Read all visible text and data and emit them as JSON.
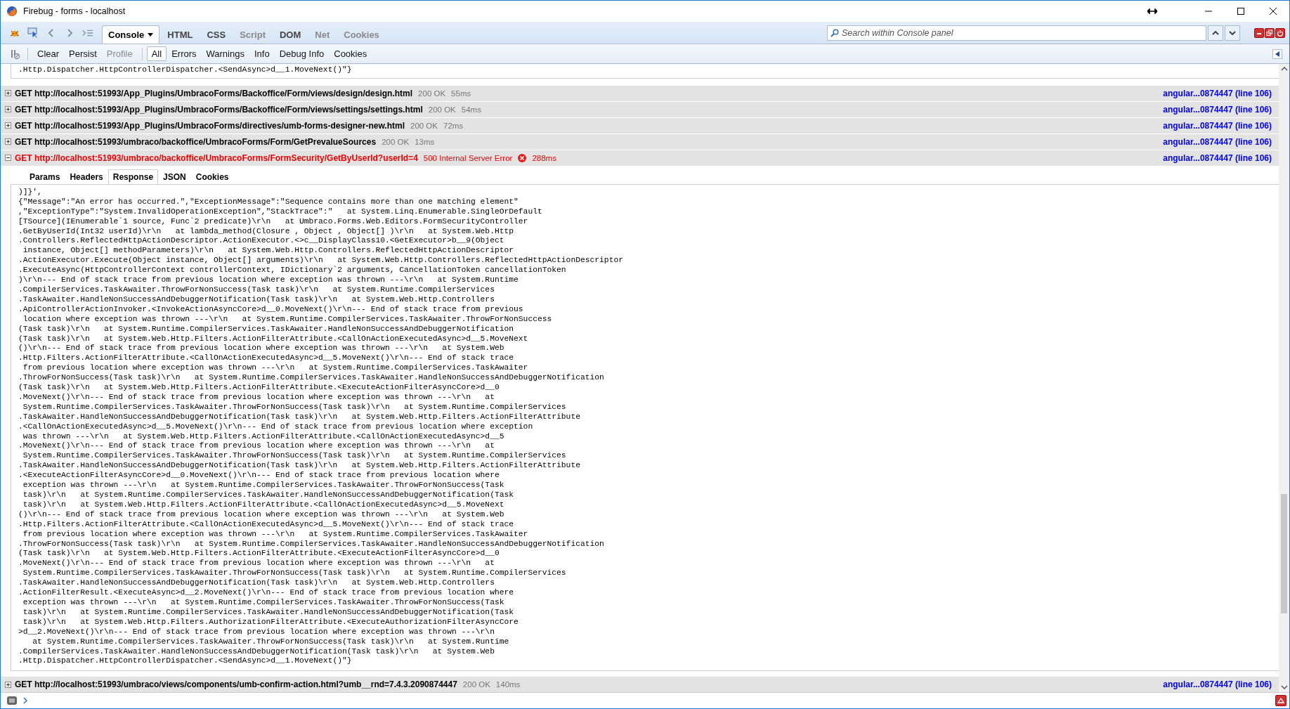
{
  "window": {
    "title": "Firebug - forms - localhost"
  },
  "panel_tabs": [
    {
      "label": "Console",
      "selected": true,
      "disabled": false,
      "dropdown": true
    },
    {
      "label": "HTML",
      "selected": false,
      "disabled": false,
      "dropdown": false
    },
    {
      "label": "CSS",
      "selected": false,
      "disabled": false,
      "dropdown": false
    },
    {
      "label": "Script",
      "selected": false,
      "disabled": true,
      "dropdown": false
    },
    {
      "label": "DOM",
      "selected": false,
      "disabled": false,
      "dropdown": false
    },
    {
      "label": "Net",
      "selected": false,
      "disabled": true,
      "dropdown": false
    },
    {
      "label": "Cookies",
      "selected": false,
      "disabled": true,
      "dropdown": false
    }
  ],
  "search": {
    "placeholder": "Search within Console panel"
  },
  "console_buttons": [
    {
      "label": "Clear",
      "disabled": false
    },
    {
      "label": "Persist",
      "disabled": false
    },
    {
      "label": "Profile",
      "disabled": true
    }
  ],
  "filters": [
    {
      "label": "All",
      "selected": true
    },
    {
      "label": "Errors",
      "selected": false
    },
    {
      "label": "Warnings",
      "selected": false
    },
    {
      "label": "Info",
      "selected": false
    },
    {
      "label": "Debug Info",
      "selected": false
    },
    {
      "label": "Cookies",
      "selected": false
    }
  ],
  "previous_response_tail": ".Http.Dispatcher.HttpControllerDispatcher.<SendAsync>d__1.MoveNext()\"}",
  "requests": [
    {
      "request": "GET http://localhost:51993/App_Plugins/UmbracoForms/Backoffice/Form/views/design/design.html",
      "status": "200 OK",
      "time": "55ms",
      "source": "angular...0874447 (line 106)",
      "error": false,
      "expanded": false
    },
    {
      "request": "GET http://localhost:51993/App_Plugins/UmbracoForms/Backoffice/Form/views/settings/settings.html",
      "status": "200 OK",
      "time": "54ms",
      "source": "angular...0874447 (line 106)",
      "error": false,
      "expanded": false
    },
    {
      "request": "GET http://localhost:51993/App_Plugins/UmbracoForms/directives/umb-forms-designer-new.html",
      "status": "200 OK",
      "time": "72ms",
      "source": "angular...0874447 (line 106)",
      "error": false,
      "expanded": false
    },
    {
      "request": "GET http://localhost:51993/umbraco/backoffice/UmbracoForms/Form/GetPrevalueSources",
      "status": "200 OK",
      "time": "13ms",
      "source": "angular...0874447 (line 106)",
      "error": false,
      "expanded": false
    },
    {
      "request": "GET http://localhost:51993/umbraco/backoffice/UmbracoForms/FormSecurity/GetByUserId?userId=4",
      "status": "500 Internal Server Error",
      "time": "288ms",
      "source": "angular...0874447 (line 106)",
      "error": true,
      "expanded": true,
      "tabs": [
        {
          "label": "Params",
          "selected": false
        },
        {
          "label": "Headers",
          "selected": false
        },
        {
          "label": "Response",
          "selected": true
        },
        {
          "label": "JSON",
          "selected": false
        },
        {
          "label": "Cookies",
          "selected": false
        }
      ],
      "response_lines": [
        ")]}',",
        "{\"Message\":\"An error has occurred.\",\"ExceptionMessage\":\"Sequence contains more than one matching element\"",
        ",\"ExceptionType\":\"System.InvalidOperationException\",\"StackTrace\":\"   at System.Linq.Enumerable.SingleOrDefault",
        "[TSource](IEnumerable`1 source, Func`2 predicate)\\r\\n   at Umbraco.Forms.Web.Editors.FormSecurityController",
        ".GetByUserId(Int32 userId)\\r\\n   at lambda_method(Closure , Object , Object[] )\\r\\n   at System.Web.Http",
        ".Controllers.ReflectedHttpActionDescriptor.ActionExecutor.<>c__DisplayClass10.<GetExecutor>b__9(Object",
        " instance, Object[] methodParameters)\\r\\n   at System.Web.Http.Controllers.ReflectedHttpActionDescriptor",
        ".ActionExecutor.Execute(Object instance, Object[] arguments)\\r\\n   at System.Web.Http.Controllers.ReflectedHttpActionDescriptor",
        ".ExecuteAsync(HttpControllerContext controllerContext, IDictionary`2 arguments, CancellationToken cancellationToken",
        ")\\r\\n--- End of stack trace from previous location where exception was thrown ---\\r\\n   at System.Runtime",
        ".CompilerServices.TaskAwaiter.ThrowForNonSuccess(Task task)\\r\\n   at System.Runtime.CompilerServices",
        ".TaskAwaiter.HandleNonSuccessAndDebuggerNotification(Task task)\\r\\n   at System.Web.Http.Controllers",
        ".ApiControllerActionInvoker.<InvokeActionAsyncCore>d__0.MoveNext()\\r\\n--- End of stack trace from previous",
        " location where exception was thrown ---\\r\\n   at System.Runtime.CompilerServices.TaskAwaiter.ThrowForNonSuccess",
        "(Task task)\\r\\n   at System.Runtime.CompilerServices.TaskAwaiter.HandleNonSuccessAndDebuggerNotification",
        "(Task task)\\r\\n   at System.Web.Http.Filters.ActionFilterAttribute.<CallOnActionExecutedAsync>d__5.MoveNext",
        "()\\r\\n--- End of stack trace from previous location where exception was thrown ---\\r\\n   at System.Web",
        ".Http.Filters.ActionFilterAttribute.<CallOnActionExecutedAsync>d__5.MoveNext()\\r\\n--- End of stack trace",
        " from previous location where exception was thrown ---\\r\\n   at System.Runtime.CompilerServices.TaskAwaiter",
        ".ThrowForNonSuccess(Task task)\\r\\n   at System.Runtime.CompilerServices.TaskAwaiter.HandleNonSuccessAndDebuggerNotification",
        "(Task task)\\r\\n   at System.Web.Http.Filters.ActionFilterAttribute.<ExecuteActionFilterAsyncCore>d__0",
        ".MoveNext()\\r\\n--- End of stack trace from previous location where exception was thrown ---\\r\\n   at",
        " System.Runtime.CompilerServices.TaskAwaiter.ThrowForNonSuccess(Task task)\\r\\n   at System.Runtime.CompilerServices",
        ".TaskAwaiter.HandleNonSuccessAndDebuggerNotification(Task task)\\r\\n   at System.Web.Http.Filters.ActionFilterAttribute",
        ".<CallOnActionExecutedAsync>d__5.MoveNext()\\r\\n--- End of stack trace from previous location where exception",
        " was thrown ---\\r\\n   at System.Web.Http.Filters.ActionFilterAttribute.<CallOnActionExecutedAsync>d__5",
        ".MoveNext()\\r\\n--- End of stack trace from previous location where exception was thrown ---\\r\\n   at",
        " System.Runtime.CompilerServices.TaskAwaiter.ThrowForNonSuccess(Task task)\\r\\n   at System.Runtime.CompilerServices",
        ".TaskAwaiter.HandleNonSuccessAndDebuggerNotification(Task task)\\r\\n   at System.Web.Http.Filters.ActionFilterAttribute",
        ".<ExecuteActionFilterAsyncCore>d__0.MoveNext()\\r\\n--- End of stack trace from previous location where",
        " exception was thrown ---\\r\\n   at System.Runtime.CompilerServices.TaskAwaiter.ThrowForNonSuccess(Task",
        " task)\\r\\n   at System.Runtime.CompilerServices.TaskAwaiter.HandleNonSuccessAndDebuggerNotification(Task",
        " task)\\r\\n   at System.Web.Http.Filters.ActionFilterAttribute.<CallOnActionExecutedAsync>d__5.MoveNext",
        "()\\r\\n--- End of stack trace from previous location where exception was thrown ---\\r\\n   at System.Web",
        ".Http.Filters.ActionFilterAttribute.<CallOnActionExecutedAsync>d__5.MoveNext()\\r\\n--- End of stack trace",
        " from previous location where exception was thrown ---\\r\\n   at System.Runtime.CompilerServices.TaskAwaiter",
        ".ThrowForNonSuccess(Task task)\\r\\n   at System.Runtime.CompilerServices.TaskAwaiter.HandleNonSuccessAndDebuggerNotification",
        "(Task task)\\r\\n   at System.Web.Http.Filters.ActionFilterAttribute.<ExecuteActionFilterAsyncCore>d__0",
        ".MoveNext()\\r\\n--- End of stack trace from previous location where exception was thrown ---\\r\\n   at",
        " System.Runtime.CompilerServices.TaskAwaiter.ThrowForNonSuccess(Task task)\\r\\n   at System.Runtime.CompilerServices",
        ".TaskAwaiter.HandleNonSuccessAndDebuggerNotification(Task task)\\r\\n   at System.Web.Http.Controllers",
        ".ActionFilterResult.<ExecuteAsync>d__2.MoveNext()\\r\\n--- End of stack trace from previous location where",
        " exception was thrown ---\\r\\n   at System.Runtime.CompilerServices.TaskAwaiter.ThrowForNonSuccess(Task",
        " task)\\r\\n   at System.Runtime.CompilerServices.TaskAwaiter.HandleNonSuccessAndDebuggerNotification(Task",
        " task)\\r\\n   at System.Web.Http.Filters.AuthorizationFilterAttribute.<ExecuteAuthorizationFilterAsyncCore",
        ">d__2.MoveNext()\\r\\n--- End of stack trace from previous location where exception was thrown ---\\r\\n",
        "   at System.Runtime.CompilerServices.TaskAwaiter.ThrowForNonSuccess(Task task)\\r\\n   at System.Runtime",
        ".CompilerServices.TaskAwaiter.HandleNonSuccessAndDebuggerNotification(Task task)\\r\\n   at System.Web",
        ".Http.Dispatcher.HttpControllerDispatcher.<SendAsync>d__1.MoveNext()\"}"
      ]
    },
    {
      "request": "GET http://localhost:51993/umbraco/views/components/umb-confirm-action.html?umb__rnd=7.4.3.2090874447",
      "status": "200 OK",
      "time": "140ms",
      "source": "angular...0874447 (line 106)",
      "error": false,
      "expanded": false
    }
  ]
}
